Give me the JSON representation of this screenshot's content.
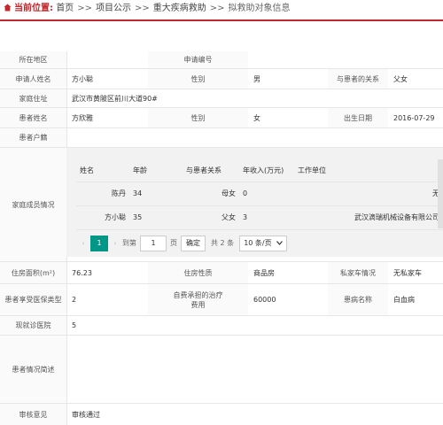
{
  "breadcrumb": {
    "label": "当前位置:",
    "items": [
      "首页",
      "项目公示",
      "重大疾病救助"
    ],
    "current": "拟救助对象信息",
    "separator": ">>"
  },
  "form": {
    "region_label": "所在地区",
    "region_value": "",
    "app_no_label": "申请编号",
    "app_no_value": "",
    "applicant_label": "申请人姓名",
    "applicant_value": "方小聪",
    "gender_label": "性别",
    "applicant_gender": "男",
    "relation_label": "与患者的关系",
    "relation_value": "父女",
    "address_label": "家庭住址",
    "address_value": "武汉市黄陂区前川大道90#",
    "patient_label": "患者姓名",
    "patient_value": "方欣雅",
    "patient_gender": "女",
    "birth_label": "出生日期",
    "birth_value": "2016-07-29",
    "household_label": "患者户籍",
    "household_value": "",
    "family_label": "家庭成员情况",
    "housing_area_label": "住房面积(m²)",
    "housing_area_value": "76.23",
    "housing_type_label": "住房性质",
    "housing_type_value": "商品房",
    "car_label": "私家车情况",
    "car_value": "无私家车",
    "insurance_label": "患者享受医保类型",
    "insurance_value": "2",
    "self_pay_label": "自费承担的治疗费用",
    "self_pay_value": "60000",
    "disease_label": "患病名称",
    "disease_value": "白血病",
    "hospital_label": "现就诊医院",
    "hospital_value": "5",
    "summary_label": "患者情况简述",
    "summary_value": "",
    "review_label": "审核意见",
    "review_value": "审核通过"
  },
  "family": {
    "headers": [
      "姓名",
      "年龄",
      "与患者关系",
      "年收入(万元)",
      "工作单位"
    ],
    "rows": [
      {
        "name": "陈丹",
        "age": "34",
        "relation": "母女",
        "income": "0",
        "work": "无"
      },
      {
        "name": "方小聪",
        "age": "35",
        "relation": "父女",
        "income": "3",
        "work": "武汉滴瑞机械设备有限公司"
      }
    ],
    "pager": {
      "prev": "‹",
      "page": "1",
      "next": "›",
      "goto_label": "到第",
      "page_input": "1",
      "page_suffix": "页",
      "confirm": "确定",
      "total": "共 2 条",
      "page_size": "10 条/页"
    }
  },
  "colors": {
    "accent": "#c0282d",
    "pager_active": "#009688"
  }
}
